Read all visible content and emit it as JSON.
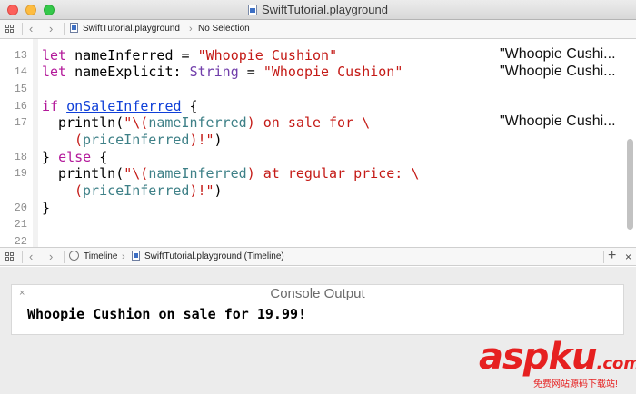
{
  "window": {
    "title": "SwiftTutorial.playground"
  },
  "top_jumpbar": {
    "file": "SwiftTutorial.playground",
    "selection": "No Selection"
  },
  "code_lines": [
    {
      "num": "13"
    },
    {
      "num": "14"
    },
    {
      "num": "15"
    },
    {
      "num": "16"
    },
    {
      "num": "17"
    },
    {
      "num": "18"
    },
    {
      "num": "19"
    },
    {
      "num": "20"
    },
    {
      "num": "21"
    },
    {
      "num": "22"
    }
  ],
  "code": {
    "l13_kw": "let",
    "l13_name": "nameInferred",
    "l13_eq": " = ",
    "l13_str": "\"Whoopie Cushion\"",
    "l14_kw": "let",
    "l14_name": "nameExplicit",
    "l14_colon": ": ",
    "l14_type": "String",
    "l14_eq": " = ",
    "l14_str": "\"Whoopie Cushion\"",
    "l16_kw": "if",
    "l16_cond": "onSaleInferred",
    "l16_brace": " {",
    "l17_fn": "println(",
    "l17_s1": "\"\\(",
    "l17_var": "nameInferred",
    "l17_s2": ") on sale for \\",
    "l17b_s1": "(",
    "l17b_var": "priceInferred",
    "l17b_s2": ")!\"",
    "l17b_end": ")",
    "l18_open": "} ",
    "l18_kw": "else",
    "l18_brace": " {",
    "l19_fn": "println(",
    "l19_s1": "\"\\(",
    "l19_var": "nameInferred",
    "l19_s2": ") at regular price: \\",
    "l19b_s1": "(",
    "l19b_var": "priceInferred",
    "l19b_s2": ")!\"",
    "l19b_end": ")",
    "l20": "}"
  },
  "results": {
    "r13": "\"Whoopie Cushi...",
    "r14": "\"Whoopie Cushi...",
    "r17": "\"Whoopie Cushi..."
  },
  "bottom_jumpbar": {
    "timeline": "Timeline",
    "file": "SwiftTutorial.playground (Timeline)"
  },
  "console": {
    "title": "Console Output",
    "close": "×",
    "output": "Whoopie Cushion on sale for 19.99!"
  },
  "watermark": {
    "main": "asp",
    "main2": "ku",
    "domain": ".com",
    "sub": "免费网站源码下载站!"
  },
  "colors": {
    "keyword": "#b3199a",
    "string": "#c41a16",
    "type": "#703daa",
    "variable": "#3e8087",
    "link": "#0f3fd8",
    "watermark": "#e62020"
  },
  "icons": [
    "grid-icon",
    "back-arrow-icon",
    "forward-arrow-icon",
    "playground-file-icon",
    "timeline-icon",
    "add-icon",
    "close-icon"
  ]
}
